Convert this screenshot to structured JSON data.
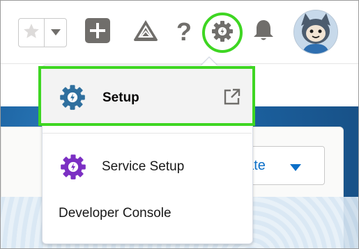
{
  "header": {
    "favorites": {
      "star_icon": "star-icon",
      "dropdown_icon": "caret-down-icon"
    },
    "global_actions_icon": "plus-icon",
    "trailhead_icon": "trailhead-icon",
    "help_icon": "question-icon",
    "help_glyph": "?",
    "setup_icon": "gear-icon",
    "notifications_icon": "bell-icon",
    "avatar": "avatar"
  },
  "setup_menu": {
    "items": [
      {
        "label": "Setup",
        "icon": "setup-gear-icon",
        "trailing_icon": "external-link-icon",
        "highlighted": true
      },
      {
        "label": "Service Setup",
        "icon": "service-setup-gear-icon"
      },
      {
        "label": "Developer Console"
      }
    ]
  },
  "background": {
    "create_button_label": "eate"
  },
  "colors": {
    "highlight": "#3ed622",
    "setup_gear": "#2f6f9e",
    "service_gear": "#7b2fc3",
    "brand_band": "#1b5f9d",
    "link_blue": "#0b6fc8"
  }
}
